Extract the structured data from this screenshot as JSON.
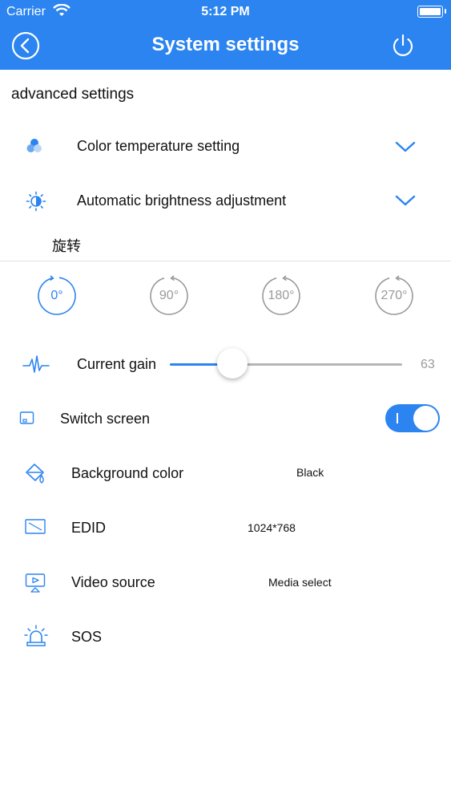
{
  "status_bar": {
    "carrier": "Carrier",
    "time": "5:12 PM"
  },
  "nav": {
    "title": "System settings"
  },
  "section": {
    "title": "advanced settings"
  },
  "color_temperature": {
    "label": "Color temperature setting"
  },
  "brightness": {
    "label": "Automatic brightness adjustment"
  },
  "rotation": {
    "label": "旋转",
    "options": [
      "0°",
      "90°",
      "180°",
      "270°"
    ],
    "selected": "0°"
  },
  "current_gain": {
    "label": "Current gain",
    "value": "63",
    "fraction": 0.27
  },
  "switch_screen": {
    "label": "Switch screen",
    "on": true
  },
  "background_color": {
    "label": "Background color",
    "value": "Black"
  },
  "edid": {
    "label": "EDID",
    "value": "1024*768"
  },
  "video_source": {
    "label": "Video source",
    "value": "Media select"
  },
  "sos": {
    "label": "SOS"
  },
  "colors": {
    "accent": "#2b84f0",
    "inactive": "#9a9a9a"
  }
}
